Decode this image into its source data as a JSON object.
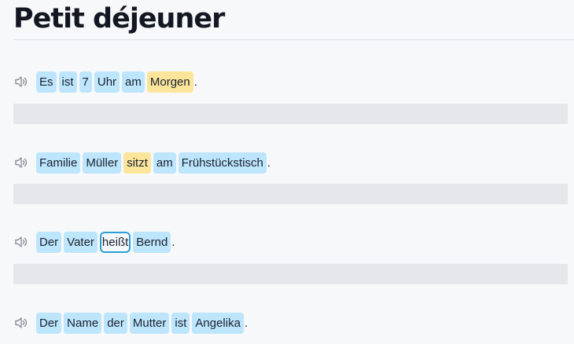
{
  "lesson": {
    "title": "Petit déjeuner"
  },
  "icons": {
    "speaker": "speaker-icon"
  },
  "sentences": [
    {
      "words": [
        {
          "text": "Es",
          "state": "normal"
        },
        {
          "text": "ist",
          "state": "normal"
        },
        {
          "text": "7",
          "state": "normal"
        },
        {
          "text": "Uhr",
          "state": "normal"
        },
        {
          "text": "am",
          "state": "normal"
        },
        {
          "text": "Morgen",
          "state": "highlight"
        }
      ],
      "punctuation": "."
    },
    {
      "words": [
        {
          "text": "Familie",
          "state": "normal"
        },
        {
          "text": "Müller",
          "state": "normal"
        },
        {
          "text": "sitzt",
          "state": "highlight"
        },
        {
          "text": "am",
          "state": "normal"
        },
        {
          "text": "Frühstückstisch",
          "state": "normal"
        }
      ],
      "punctuation": "."
    },
    {
      "words": [
        {
          "text": "Der",
          "state": "normal"
        },
        {
          "text": "Vater",
          "state": "normal"
        },
        {
          "text": "heißt",
          "state": "selected"
        },
        {
          "text": "Bernd",
          "state": "normal"
        }
      ],
      "punctuation": "."
    },
    {
      "words": [
        {
          "text": "Der",
          "state": "normal"
        },
        {
          "text": "Name",
          "state": "normal"
        },
        {
          "text": "der",
          "state": "normal"
        },
        {
          "text": "Mutter",
          "state": "normal"
        },
        {
          "text": "ist",
          "state": "normal"
        },
        {
          "text": "Angelika",
          "state": "normal"
        }
      ],
      "punctuation": "."
    }
  ],
  "colors": {
    "word_bg": "#bde5fb",
    "highlight_bg": "#fbe59b",
    "selected_border": "#2b9fd3",
    "answer_bar": "#e6e7ea"
  }
}
